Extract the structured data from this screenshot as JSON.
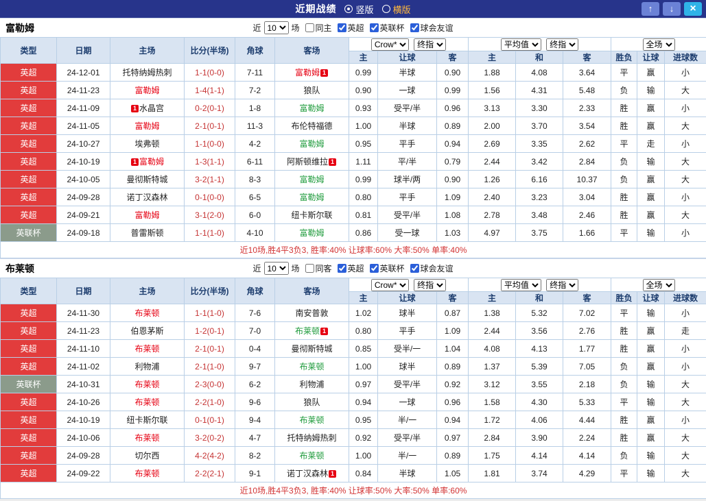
{
  "titlebar": {
    "title": "近期战绩",
    "vertical_label": "竖版",
    "horizontal_label": "横版",
    "up_glyph": "↑",
    "down_glyph": "↓",
    "close_glyph": "×"
  },
  "colors": {
    "titlebar_bg": "#27348b",
    "header_bg": "#d9e4f2",
    "league_premier_red": "#e23c3c",
    "league_cup_gray": "#8b9b8b",
    "win_red": "#e60012",
    "draw_walk_green": "#1f9b3c",
    "lose_blue": "#2244cc",
    "score_red": "#c53333",
    "summary_red": "#d23333",
    "close_button_cyan": "#2fb3e8",
    "nav_button_blue": "#6b82d6"
  },
  "sections": [
    {
      "team": "富勒姆",
      "filters": {
        "near_label": "近",
        "count": "10",
        "games_label": "场",
        "same_label": "同主",
        "same_checked": false,
        "leagues": [
          {
            "label": "英超",
            "checked": true
          },
          {
            "label": "英联杯",
            "checked": true
          },
          {
            "label": "球会友谊",
            "checked": true
          }
        ]
      },
      "dropdowns": {
        "source": "Crow*",
        "source_time": "终指",
        "avg": "平均值",
        "avg_time": "终指",
        "scope": "全场"
      },
      "headers": {
        "type": "类型",
        "date": "日期",
        "home": "主场",
        "score": "比分(半场)",
        "corners": "角球",
        "away": "客场",
        "odds_home": "主",
        "odds_handicap": "让球",
        "odds_away": "客",
        "avg_home": "主",
        "avg_draw": "和",
        "avg_away": "客",
        "result": "胜负",
        "handicap_result": "让球",
        "goals": "进球数"
      },
      "rows": [
        {
          "league": "英超",
          "league_color": "premier",
          "date": "24-12-01",
          "home": "托特纳姆热刺",
          "home_color": "black",
          "home_badge": false,
          "score": "1-1(0-0)",
          "corners": "7-11",
          "away": "富勒姆",
          "away_color": "red",
          "away_badge": true,
          "odds": [
            "0.99",
            "半球",
            "0.90"
          ],
          "avg": [
            "1.88",
            "4.08",
            "3.64"
          ],
          "results": [
            {
              "t": "平",
              "c": "green"
            },
            {
              "t": "赢",
              "c": "red"
            },
            {
              "t": "小",
              "c": "blue"
            }
          ]
        },
        {
          "league": "英超",
          "league_color": "premier",
          "date": "24-11-23",
          "home": "富勒姆",
          "home_color": "red",
          "home_badge": false,
          "score": "1-4(1-1)",
          "corners": "7-2",
          "away": "狼队",
          "away_color": "black",
          "away_badge": false,
          "odds": [
            "0.90",
            "一球",
            "0.99"
          ],
          "avg": [
            "1.56",
            "4.31",
            "5.48"
          ],
          "results": [
            {
              "t": "负",
              "c": "blue"
            },
            {
              "t": "输",
              "c": "blue"
            },
            {
              "t": "大",
              "c": "red"
            }
          ]
        },
        {
          "league": "英超",
          "league_color": "premier",
          "date": "24-11-09",
          "home": "水晶宫",
          "home_color": "black",
          "home_badge": true,
          "score": "0-2(0-1)",
          "corners": "1-8",
          "away": "富勒姆",
          "away_color": "green",
          "away_badge": false,
          "odds": [
            "0.93",
            "受平/半",
            "0.96"
          ],
          "avg": [
            "3.13",
            "3.30",
            "2.33"
          ],
          "results": [
            {
              "t": "胜",
              "c": "red"
            },
            {
              "t": "赢",
              "c": "red"
            },
            {
              "t": "小",
              "c": "blue"
            }
          ]
        },
        {
          "league": "英超",
          "league_color": "premier",
          "date": "24-11-05",
          "home": "富勒姆",
          "home_color": "red",
          "home_badge": false,
          "score": "2-1(0-1)",
          "corners": "11-3",
          "away": "布伦特福德",
          "away_color": "black",
          "away_badge": false,
          "odds": [
            "1.00",
            "半球",
            "0.89"
          ],
          "avg": [
            "2.00",
            "3.70",
            "3.54"
          ],
          "results": [
            {
              "t": "胜",
              "c": "red"
            },
            {
              "t": "赢",
              "c": "red"
            },
            {
              "t": "大",
              "c": "red"
            }
          ]
        },
        {
          "league": "英超",
          "league_color": "premier",
          "date": "24-10-27",
          "home": "埃弗顿",
          "home_color": "black",
          "home_badge": false,
          "score": "1-1(0-0)",
          "corners": "4-2",
          "away": "富勒姆",
          "away_color": "green",
          "away_badge": false,
          "odds": [
            "0.95",
            "平手",
            "0.94"
          ],
          "avg": [
            "2.69",
            "3.35",
            "2.62"
          ],
          "results": [
            {
              "t": "平",
              "c": "green"
            },
            {
              "t": "走",
              "c": "green"
            },
            {
              "t": "小",
              "c": "blue"
            }
          ]
        },
        {
          "league": "英超",
          "league_color": "premier",
          "date": "24-10-19",
          "home": "富勒姆",
          "home_color": "red",
          "home_badge": true,
          "score": "1-3(1-1)",
          "corners": "6-11",
          "away": "阿斯顿维拉",
          "away_color": "black",
          "away_badge": true,
          "odds": [
            "1.11",
            "平/半",
            "0.79"
          ],
          "avg": [
            "2.44",
            "3.42",
            "2.84"
          ],
          "results": [
            {
              "t": "负",
              "c": "blue"
            },
            {
              "t": "输",
              "c": "blue"
            },
            {
              "t": "大",
              "c": "red"
            }
          ]
        },
        {
          "league": "英超",
          "league_color": "premier",
          "date": "24-10-05",
          "home": "曼彻斯特城",
          "home_color": "black",
          "home_badge": false,
          "score": "3-2(1-1)",
          "corners": "8-3",
          "away": "富勒姆",
          "away_color": "green",
          "away_badge": false,
          "odds": [
            "0.99",
            "球半/两",
            "0.90"
          ],
          "avg": [
            "1.26",
            "6.16",
            "10.37"
          ],
          "results": [
            {
              "t": "负",
              "c": "blue"
            },
            {
              "t": "赢",
              "c": "red"
            },
            {
              "t": "大",
              "c": "red"
            }
          ]
        },
        {
          "league": "英超",
          "league_color": "premier",
          "date": "24-09-28",
          "home": "诺丁汉森林",
          "home_color": "black",
          "home_badge": false,
          "score": "0-1(0-0)",
          "corners": "6-5",
          "away": "富勒姆",
          "away_color": "green",
          "away_badge": false,
          "odds": [
            "0.80",
            "平手",
            "1.09"
          ],
          "avg": [
            "2.40",
            "3.23",
            "3.04"
          ],
          "results": [
            {
              "t": "胜",
              "c": "red"
            },
            {
              "t": "赢",
              "c": "red"
            },
            {
              "t": "小",
              "c": "blue"
            }
          ]
        },
        {
          "league": "英超",
          "league_color": "premier",
          "date": "24-09-21",
          "home": "富勒姆",
          "home_color": "red",
          "home_badge": false,
          "score": "3-1(2-0)",
          "corners": "6-0",
          "away": "纽卡斯尔联",
          "away_color": "black",
          "away_badge": false,
          "odds": [
            "0.81",
            "受平/半",
            "1.08"
          ],
          "avg": [
            "2.78",
            "3.48",
            "2.46"
          ],
          "results": [
            {
              "t": "胜",
              "c": "red"
            },
            {
              "t": "赢",
              "c": "red"
            },
            {
              "t": "大",
              "c": "red"
            }
          ]
        },
        {
          "league": "英联杯",
          "league_color": "cup",
          "date": "24-09-18",
          "home": "普雷斯顿",
          "home_color": "black",
          "home_badge": false,
          "score": "1-1(1-0)",
          "corners": "4-10",
          "away": "富勒姆",
          "away_color": "green",
          "away_badge": false,
          "odds": [
            "0.86",
            "受一球",
            "1.03"
          ],
          "avg": [
            "4.97",
            "3.75",
            "1.66"
          ],
          "results": [
            {
              "t": "平",
              "c": "green"
            },
            {
              "t": "输",
              "c": "blue"
            },
            {
              "t": "小",
              "c": "blue"
            }
          ]
        }
      ],
      "summary": "近10场,胜4平3负3, 胜率:40% 让球率:60% 大率:50% 单率:40%"
    },
    {
      "team": "布莱顿",
      "filters": {
        "near_label": "近",
        "count": "10",
        "games_label": "场",
        "same_label": "同客",
        "same_checked": false,
        "leagues": [
          {
            "label": "英超",
            "checked": true
          },
          {
            "label": "英联杯",
            "checked": true
          },
          {
            "label": "球会友谊",
            "checked": true
          }
        ]
      },
      "dropdowns": {
        "source": "Crow*",
        "source_time": "终指",
        "avg": "平均值",
        "avg_time": "终指",
        "scope": "全场"
      },
      "headers": {
        "type": "类型",
        "date": "日期",
        "home": "主场",
        "score": "比分(半场)",
        "corners": "角球",
        "away": "客场",
        "odds_home": "主",
        "odds_handicap": "让球",
        "odds_away": "客",
        "avg_home": "主",
        "avg_draw": "和",
        "avg_away": "客",
        "result": "胜负",
        "handicap_result": "让球",
        "goals": "进球数"
      },
      "rows": [
        {
          "league": "英超",
          "league_color": "premier",
          "date": "24-11-30",
          "home": "布莱顿",
          "home_color": "red",
          "home_badge": false,
          "score": "1-1(1-0)",
          "corners": "7-6",
          "away": "南安普敦",
          "away_color": "black",
          "away_badge": false,
          "odds": [
            "1.02",
            "球半",
            "0.87"
          ],
          "avg": [
            "1.38",
            "5.32",
            "7.02"
          ],
          "results": [
            {
              "t": "平",
              "c": "green"
            },
            {
              "t": "输",
              "c": "blue"
            },
            {
              "t": "小",
              "c": "blue"
            }
          ]
        },
        {
          "league": "英超",
          "league_color": "premier",
          "date": "24-11-23",
          "home": "伯恩茅斯",
          "home_color": "black",
          "home_badge": false,
          "score": "1-2(0-1)",
          "corners": "7-0",
          "away": "布莱顿",
          "away_color": "green",
          "away_badge": true,
          "odds": [
            "0.80",
            "平手",
            "1.09"
          ],
          "avg": [
            "2.44",
            "3.56",
            "2.76"
          ],
          "results": [
            {
              "t": "胜",
              "c": "red"
            },
            {
              "t": "赢",
              "c": "red"
            },
            {
              "t": "走",
              "c": "green"
            }
          ]
        },
        {
          "league": "英超",
          "league_color": "premier",
          "date": "24-11-10",
          "home": "布莱顿",
          "home_color": "red",
          "home_badge": false,
          "score": "2-1(0-1)",
          "corners": "0-4",
          "away": "曼彻斯特城",
          "away_color": "black",
          "away_badge": false,
          "odds": [
            "0.85",
            "受半/一",
            "1.04"
          ],
          "avg": [
            "4.08",
            "4.13",
            "1.77"
          ],
          "results": [
            {
              "t": "胜",
              "c": "red"
            },
            {
              "t": "赢",
              "c": "red"
            },
            {
              "t": "小",
              "c": "blue"
            }
          ]
        },
        {
          "league": "英超",
          "league_color": "premier",
          "date": "24-11-02",
          "home": "利物浦",
          "home_color": "black",
          "home_badge": false,
          "score": "2-1(1-0)",
          "corners": "9-7",
          "away": "布莱顿",
          "away_color": "green",
          "away_badge": false,
          "odds": [
            "1.00",
            "球半",
            "0.89"
          ],
          "avg": [
            "1.37",
            "5.39",
            "7.05"
          ],
          "results": [
            {
              "t": "负",
              "c": "blue"
            },
            {
              "t": "赢",
              "c": "red"
            },
            {
              "t": "小",
              "c": "blue"
            }
          ]
        },
        {
          "league": "英联杯",
          "league_color": "cup",
          "date": "24-10-31",
          "home": "布莱顿",
          "home_color": "red",
          "home_badge": false,
          "score": "2-3(0-0)",
          "corners": "6-2",
          "away": "利物浦",
          "away_color": "black",
          "away_badge": false,
          "odds": [
            "0.97",
            "受平/半",
            "0.92"
          ],
          "avg": [
            "3.12",
            "3.55",
            "2.18"
          ],
          "results": [
            {
              "t": "负",
              "c": "blue"
            },
            {
              "t": "输",
              "c": "blue"
            },
            {
              "t": "大",
              "c": "red"
            }
          ]
        },
        {
          "league": "英超",
          "league_color": "premier",
          "date": "24-10-26",
          "home": "布莱顿",
          "home_color": "red",
          "home_badge": false,
          "score": "2-2(1-0)",
          "corners": "9-6",
          "away": "狼队",
          "away_color": "black",
          "away_badge": false,
          "odds": [
            "0.94",
            "一球",
            "0.96"
          ],
          "avg": [
            "1.58",
            "4.30",
            "5.33"
          ],
          "results": [
            {
              "t": "平",
              "c": "green"
            },
            {
              "t": "输",
              "c": "blue"
            },
            {
              "t": "大",
              "c": "red"
            }
          ]
        },
        {
          "league": "英超",
          "league_color": "premier",
          "date": "24-10-19",
          "home": "纽卡斯尔联",
          "home_color": "black",
          "home_badge": false,
          "score": "0-1(0-1)",
          "corners": "9-4",
          "away": "布莱顿",
          "away_color": "green",
          "away_badge": false,
          "odds": [
            "0.95",
            "半/一",
            "0.94"
          ],
          "avg": [
            "1.72",
            "4.06",
            "4.44"
          ],
          "results": [
            {
              "t": "胜",
              "c": "red"
            },
            {
              "t": "赢",
              "c": "red"
            },
            {
              "t": "小",
              "c": "blue"
            }
          ]
        },
        {
          "league": "英超",
          "league_color": "premier",
          "date": "24-10-06",
          "home": "布莱顿",
          "home_color": "red",
          "home_badge": false,
          "score": "3-2(0-2)",
          "corners": "4-7",
          "away": "托特纳姆热刺",
          "away_color": "black",
          "away_badge": false,
          "odds": [
            "0.92",
            "受平/半",
            "0.97"
          ],
          "avg": [
            "2.84",
            "3.90",
            "2.24"
          ],
          "results": [
            {
              "t": "胜",
              "c": "red"
            },
            {
              "t": "赢",
              "c": "red"
            },
            {
              "t": "大",
              "c": "red"
            }
          ]
        },
        {
          "league": "英超",
          "league_color": "premier",
          "date": "24-09-28",
          "home": "切尔西",
          "home_color": "black",
          "home_badge": false,
          "score": "4-2(4-2)",
          "corners": "8-2",
          "away": "布莱顿",
          "away_color": "green",
          "away_badge": false,
          "odds": [
            "1.00",
            "半/一",
            "0.89"
          ],
          "avg": [
            "1.75",
            "4.14",
            "4.14"
          ],
          "results": [
            {
              "t": "负",
              "c": "blue"
            },
            {
              "t": "输",
              "c": "blue"
            },
            {
              "t": "大",
              "c": "red"
            }
          ]
        },
        {
          "league": "英超",
          "league_color": "premier",
          "date": "24-09-22",
          "home": "布莱顿",
          "home_color": "red",
          "home_badge": false,
          "score": "2-2(2-1)",
          "corners": "9-1",
          "away": "诺丁汉森林",
          "away_color": "black",
          "away_badge": true,
          "odds": [
            "0.84",
            "半球",
            "1.05"
          ],
          "avg": [
            "1.81",
            "3.74",
            "4.29"
          ],
          "results": [
            {
              "t": "平",
              "c": "green"
            },
            {
              "t": "输",
              "c": "blue"
            },
            {
              "t": "大",
              "c": "red"
            }
          ]
        }
      ],
      "summary": "近10场,胜4平3负3, 胜率:40% 让球率:50% 大率:50% 单率:60%"
    }
  ]
}
